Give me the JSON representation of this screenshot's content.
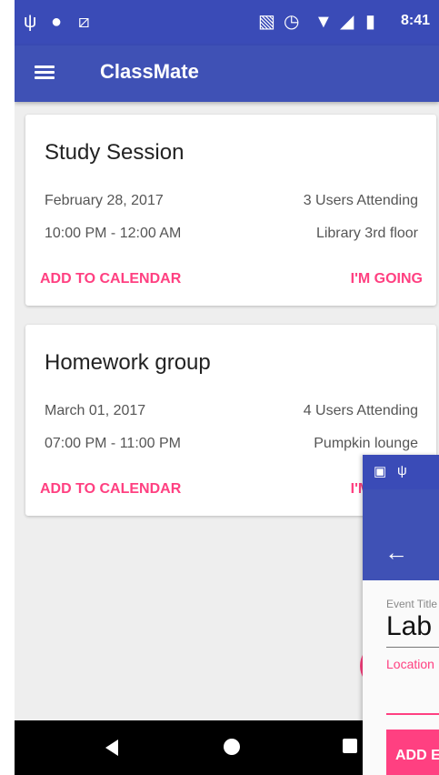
{
  "status_bar": {
    "left_icons": [
      "usb-icon",
      "android-debug-icon",
      "wifi-signal-icon"
    ],
    "right_icons": [
      "vibrate-icon",
      "alarm-icon",
      "wifi-icon",
      "cell-signal-icon",
      "battery-charging-icon"
    ],
    "time": "8:41"
  },
  "app_bar": {
    "title": "ClassMate",
    "menu_icon": "menu-icon"
  },
  "events": [
    {
      "title": "Study Session",
      "date": "February 28, 2017",
      "time_range": "10:00 PM - 12:00 AM",
      "attending": "3 Users Attending",
      "location": "Library 3rd floor",
      "add_label": "ADD TO CALENDAR",
      "going_label": "I'M GOING"
    },
    {
      "title": "Homework group",
      "date": "March 01, 2017",
      "time_range": "07:00 PM - 11:00 PM",
      "attending": "4 Users Attending",
      "location": "Pumpkin lounge",
      "add_label": "ADD TO CALENDAR",
      "going_label": "I'M GOING"
    }
  ],
  "overlay": {
    "status_icons": [
      "image-icon",
      "usb-icon"
    ],
    "back_icon": "arrow-back-icon",
    "event_title_label": "Event Title",
    "event_title_value": "Lab",
    "location_label": "Location",
    "add_button_label": "ADD EVENT"
  },
  "nav_bar": {
    "icons": [
      "back-triangle-icon",
      "home-circle-icon",
      "recents-square-icon"
    ]
  },
  "colors": {
    "primary": "#3f51b5",
    "primary_dark": "#3a4bb7",
    "accent": "#ff4081",
    "background": "#eeeeee",
    "nav": "#000000"
  }
}
